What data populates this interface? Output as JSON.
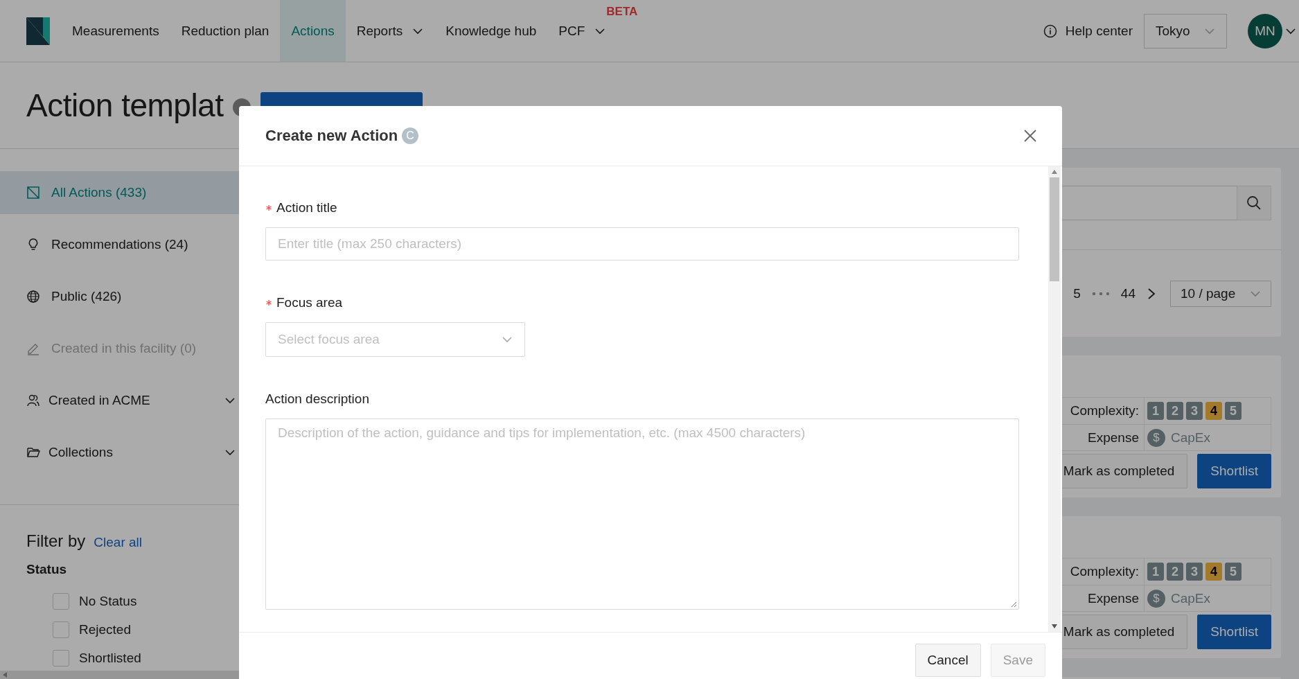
{
  "header": {
    "nav": [
      {
        "label": "Measurements",
        "selected": false,
        "dropdown": false
      },
      {
        "label": "Reduction plan",
        "selected": false,
        "dropdown": false
      },
      {
        "label": "Actions",
        "selected": true,
        "dropdown": false
      },
      {
        "label": "Reports",
        "selected": false,
        "dropdown": true
      },
      {
        "label": "Knowledge hub",
        "selected": false,
        "dropdown": false
      },
      {
        "label": "PCF",
        "selected": false,
        "dropdown": true,
        "badge": "BETA"
      }
    ],
    "help": "Help center",
    "location": "Tokyo",
    "avatar": "MN"
  },
  "page": {
    "title": "Action templat"
  },
  "sidebar": {
    "items": [
      {
        "label": "All Actions (433)",
        "kind": "link",
        "selected": true,
        "disabled": false
      },
      {
        "label": "Recommendations (24)",
        "kind": "link",
        "selected": false,
        "disabled": false
      },
      {
        "label": "Public (426)",
        "kind": "link",
        "selected": false,
        "disabled": false
      },
      {
        "label": "Created in this facility (0)",
        "kind": "link",
        "selected": false,
        "disabled": true
      },
      {
        "label": "Created in ACME",
        "kind": "group",
        "selected": false,
        "disabled": false,
        "expanded": false
      },
      {
        "label": "Collections",
        "kind": "group",
        "selected": false,
        "disabled": false,
        "expanded": false
      }
    ],
    "filter": {
      "title": "Filter by",
      "clear": "Clear all",
      "group": "Status",
      "options": [
        {
          "label": "No Status",
          "checked": false
        },
        {
          "label": "Rejected",
          "checked": false
        },
        {
          "label": "Shortlisted",
          "checked": false
        }
      ]
    }
  },
  "content": {
    "pagination": {
      "pages": [
        {
          "kind": "page",
          "label": "5"
        },
        {
          "kind": "ellipsis"
        },
        {
          "kind": "page",
          "label": "44"
        }
      ],
      "page_size": "10 / page"
    },
    "cards": [
      {
        "complexity_label": "Complexity:",
        "complexity": [
          {
            "label": "1",
            "selected": false
          },
          {
            "label": "2",
            "selected": false
          },
          {
            "label": "3",
            "selected": false
          },
          {
            "label": "4",
            "selected": true
          },
          {
            "label": "5",
            "selected": false
          }
        ],
        "expense_label": "Expense",
        "expense_symbol": "$",
        "expense": "CapEx",
        "buttons": [
          {
            "label": "Mark as completed",
            "kind": "default"
          },
          {
            "label": "Shortlist",
            "kind": "primary"
          }
        ]
      },
      {
        "complexity_label": "Complexity:",
        "complexity": [
          {
            "label": "1",
            "selected": false
          },
          {
            "label": "2",
            "selected": false
          },
          {
            "label": "3",
            "selected": false
          },
          {
            "label": "4",
            "selected": true
          },
          {
            "label": "5",
            "selected": false
          }
        ],
        "expense_label": "Expense",
        "expense_symbol": "$",
        "expense": "CapEx",
        "buttons": [
          {
            "label": "Mark as completed",
            "kind": "default"
          },
          {
            "label": "Shortlist",
            "kind": "primary"
          }
        ]
      }
    ]
  },
  "modal": {
    "title": "Create new Action",
    "title_badge": "C",
    "fields": [
      {
        "kind": "input",
        "label": "Action title",
        "required": true,
        "placeholder": "Enter title (max 250 characters)"
      },
      {
        "kind": "select",
        "label": "Focus area",
        "required": true,
        "placeholder": "Select focus area"
      },
      {
        "kind": "textarea",
        "label": "Action description",
        "required": false,
        "placeholder": "Description of the action, guidance and tips for implementation, etc. (max 4500 characters)"
      }
    ],
    "buttons": [
      {
        "label": "Cancel",
        "disabled": false
      },
      {
        "label": "Save",
        "disabled": true
      }
    ]
  }
}
